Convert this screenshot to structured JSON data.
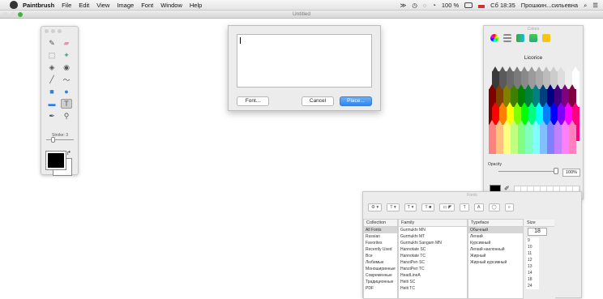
{
  "menubar": {
    "items": [
      "Paintbrush",
      "File",
      "Edit",
      "View",
      "Image",
      "Font",
      "Window",
      "Help"
    ],
    "battery": "100 %",
    "clock": "Сб 18:35",
    "user": "Прошкин...сильевна"
  },
  "window": {
    "title": "Untitled"
  },
  "tools": {
    "stroke_label": "Stroke: 3"
  },
  "text_dialog": {
    "font_button": "Font...",
    "cancel_button": "Cancel",
    "place_button": "Place..."
  },
  "colors_panel": {
    "title": "Colors",
    "color_name": "Licorice",
    "opacity_label": "Opacity",
    "opacity_value": "100%",
    "selected_color": "#000000"
  },
  "fonts_panel": {
    "title": "Fonts",
    "headers": {
      "collection": "Collection",
      "family": "Family",
      "typeface": "Typeface",
      "size": "Size"
    },
    "size_value": "18",
    "collections": [
      "All Fonts",
      "Russian",
      "Favorites",
      "Recently Used",
      "Все",
      "Любимые",
      "Моноширинные",
      "Современные",
      "Традиционные",
      "PDF"
    ],
    "families": [
      "Gurmukhi MN",
      "Gurmukhi MT",
      "Gurmukhi Sangam MN",
      "Hannotate SC",
      "Hannotate TC",
      "HanziPen SC",
      "HanziPen TC",
      "HeadLineA",
      "Heiti SC",
      "Heiti TC"
    ],
    "typefaces": [
      "Обычный",
      "Легкий",
      "Курсивный",
      "Легкий наклонный",
      "Жирный",
      "Жирный курсивный"
    ],
    "sizes": [
      "9",
      "10",
      "11",
      "12",
      "13",
      "14",
      "18",
      "24"
    ]
  }
}
